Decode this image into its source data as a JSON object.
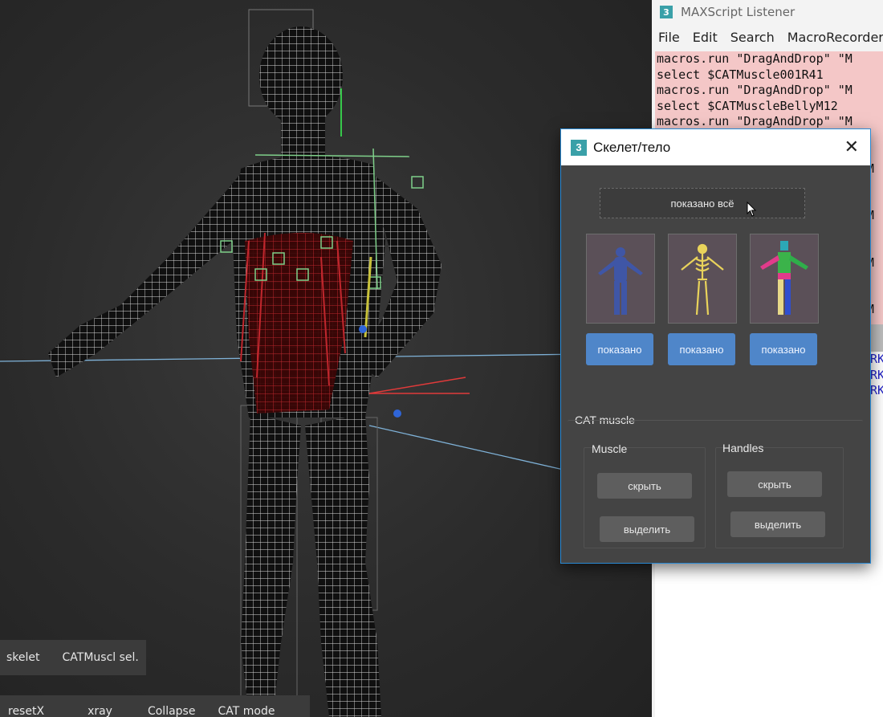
{
  "listener": {
    "title": "MAXScript Listener",
    "menu": [
      "File",
      "Edit",
      "Search",
      "MacroRecorder"
    ],
    "macro_lines": [
      "macros.run \"DragAndDrop\" \"M",
      "select $CATMuscle001R41",
      "macros.run \"DragAndDrop\" \"M",
      "select $CATMuscleBellyM12",
      "macros.run \"DragAndDrop\" \"M",
      "",
      "",
      "                            \"M",
      "",
      "",
      "                            \"M",
      "",
      "",
      "                            \"M",
      "",
      "",
      "                            \"M"
    ],
    "output_lines": [
      "RK",
      "RK",
      "RK"
    ]
  },
  "dialog": {
    "title": "Скелет/тело",
    "show_all_label": "показано всё",
    "thumbnails": [
      {
        "name": "body",
        "label": "показано"
      },
      {
        "name": "skeleton",
        "label": "показано"
      },
      {
        "name": "cat-rig",
        "label": "показано"
      }
    ],
    "cat_muscle_title": "CAT muscle",
    "muscle_group": {
      "title": "Muscle",
      "hide_label": "скрыть",
      "select_label": "выделить"
    },
    "handles_group": {
      "title": "Handles",
      "hide_label": "скрыть",
      "select_label": "выделить"
    }
  },
  "viewport": {
    "buttons_row1": [
      "skelet",
      "CATMuscl sel."
    ],
    "buttons_row2": [
      "resetX",
      "xray",
      "Collapse",
      "CAT mode"
    ]
  },
  "colors": {
    "wire": "#ffffff",
    "muscle": "#c1272d",
    "accent_blue": "#4f86c9",
    "helper_green": "#7fd08a"
  }
}
